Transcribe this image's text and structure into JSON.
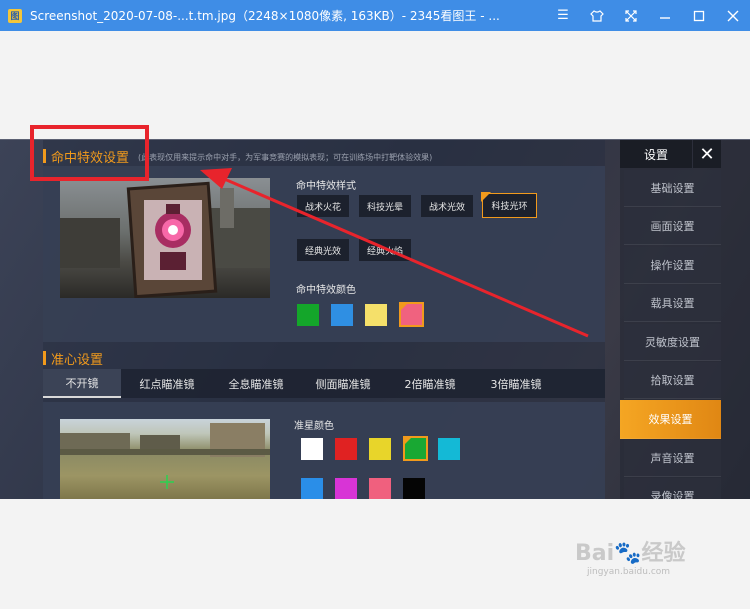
{
  "window": {
    "title": "Screenshot_2020-07-08-...t.tm.jpg（2248×1080像素, 163KB）- 2345看图王 - ...",
    "buttons": [
      "menu",
      "skin",
      "fullscreen",
      "minimize",
      "maximize",
      "close"
    ]
  },
  "hit_effect": {
    "title": "命中特效设置",
    "note": "(此表现仅用来提示命中对手，为军事竞赛的模拟表现；可在训练场中打靶体验效果)",
    "style_label": "命中特效样式",
    "styles": [
      "战术火花",
      "科技光晕",
      "战术光效",
      "科技光环",
      "经典光效",
      "经典火焰"
    ],
    "selected_style": "科技光环",
    "color_label": "命中特效颜色",
    "colors": [
      "#14a62a",
      "#2f8fe3",
      "#f5e06a",
      "#f0627f"
    ],
    "selected_color_index": 3
  },
  "crosshair": {
    "title": "准心设置",
    "tabs": [
      "不开镜",
      "红点瞄准镜",
      "全息瞄准镜",
      "侧面瞄准镜",
      "2倍瞄准镜",
      "3倍瞄准镜"
    ],
    "active_tab": "不开镜",
    "color_label": "准星颜色",
    "colors": [
      "#ffffff",
      "#e02222",
      "#e8d52a",
      "#19a833",
      "#14b9d6",
      "#2a8ee8",
      "#d834d6",
      "#f0607e",
      "#050505"
    ],
    "selected_color_index": 3
  },
  "sidebar": {
    "header": "设置",
    "close": "✕",
    "items": [
      "基础设置",
      "画面设置",
      "操作设置",
      "载具设置",
      "灵敏度设置",
      "拾取设置",
      "效果设置",
      "声音设置",
      "录像设置"
    ],
    "active": "效果设置"
  },
  "annotation": {
    "color": "#e8242c"
  },
  "watermark": {
    "main": "Bai🐾经验",
    "sub": "jingyan.baidu.com"
  }
}
